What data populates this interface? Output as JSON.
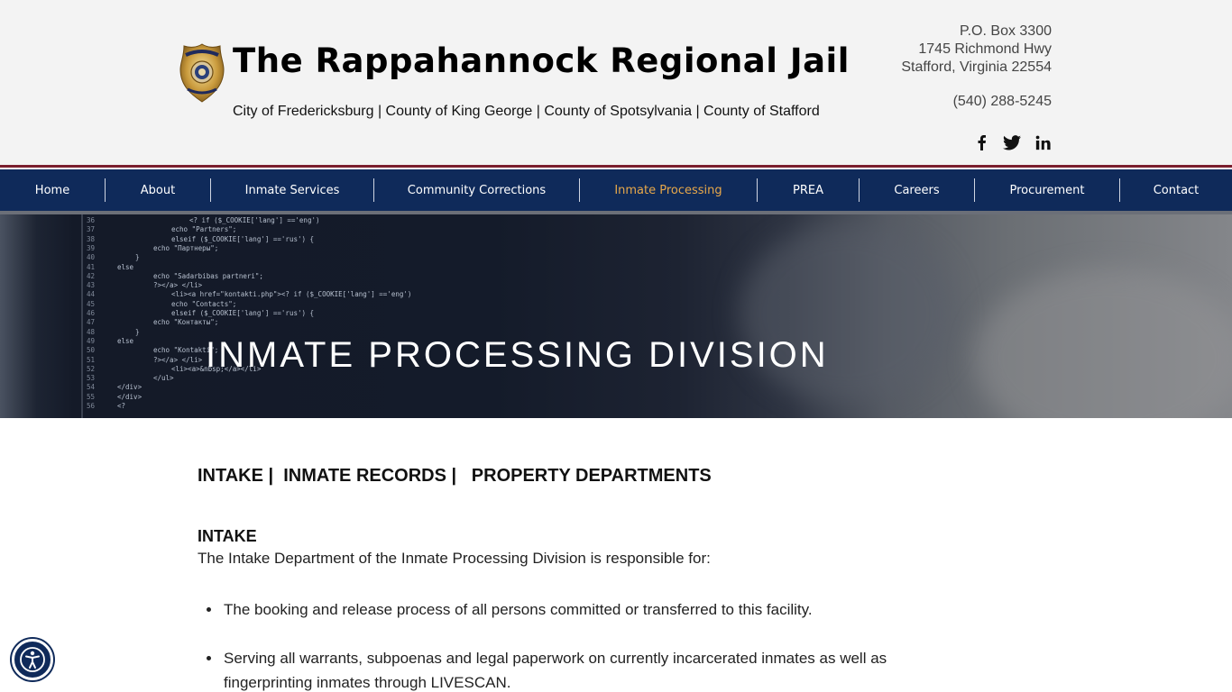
{
  "header": {
    "title": "The Rappahannock Regional Jail",
    "localities": "City of Fredericksburg  | County of King George  |  County of Spotsylvania  |  County of Stafford",
    "address_lines": [
      "P.O. Box 3300",
      "1745 Richmond Hwy",
      "Stafford, Virginia 22554"
    ],
    "phone": "(540) 288-5245",
    "social": [
      {
        "name": "facebook-icon"
      },
      {
        "name": "twitter-icon"
      },
      {
        "name": "linkedin-icon"
      }
    ]
  },
  "nav": {
    "items": [
      {
        "label": "Home"
      },
      {
        "label": "About"
      },
      {
        "label": "Inmate Services"
      },
      {
        "label": "Community Corrections"
      },
      {
        "label": "Inmate Processing",
        "active": true
      },
      {
        "label": "PREA"
      },
      {
        "label": "Careers"
      },
      {
        "label": "Procurement"
      },
      {
        "label": "Contact"
      }
    ],
    "active_color": "#e8a84a",
    "background": "#0f2a5a"
  },
  "hero": {
    "title": "INMATE PROCESSING DIVISION"
  },
  "content": {
    "sub_nav": "INTAKE |  INMATE RECORDS |   PROPERTY DEPARTMENTS",
    "section_title": "INTAKE",
    "intro": "The Intake Department of the Inmate Processing Division is responsible for:",
    "bullets": [
      "The booking and release process of all persons committed or transferred to this facility.",
      "Serving all warrants, subpoenas and legal paperwork on currently incarcerated inmates as well as fingerprinting inmates through LIVESCAN."
    ]
  },
  "accessibility": {
    "icon": "accessibility-icon"
  }
}
